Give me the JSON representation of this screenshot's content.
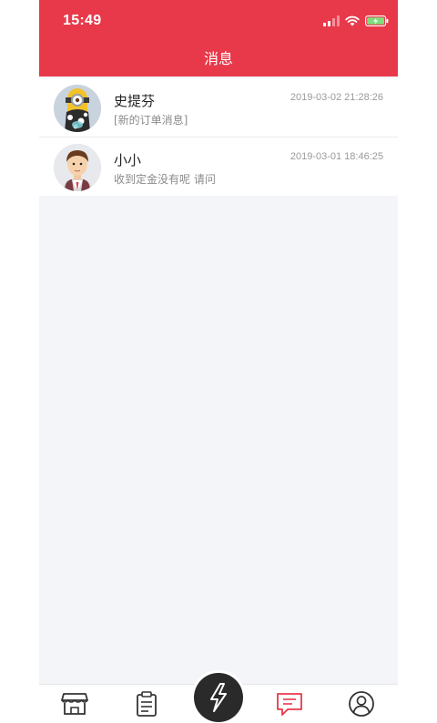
{
  "status_bar": {
    "time": "15:49",
    "icons": [
      "cellular-signal-icon",
      "wifi-icon",
      "battery-charging-icon"
    ]
  },
  "header": {
    "title": "消息"
  },
  "conversations": [
    {
      "name": "史提芬",
      "preview": "[新的订单消息]",
      "time": "2019-03-02 21:28:26",
      "avatar": "minion-avatar"
    },
    {
      "name": "小小",
      "preview": "收到定金没有呢 请问",
      "time": "2019-03-01 18:46:25",
      "avatar": "cartoon-man-avatar"
    }
  ],
  "tab_bar": {
    "tabs": [
      "store-icon",
      "clipboard-icon",
      "lightning-icon",
      "message-icon",
      "profile-icon"
    ],
    "active": "message-icon"
  },
  "colors": {
    "accent": "#e8394a",
    "background": "#f4f5f8",
    "center_button": "#2a2a2a"
  }
}
